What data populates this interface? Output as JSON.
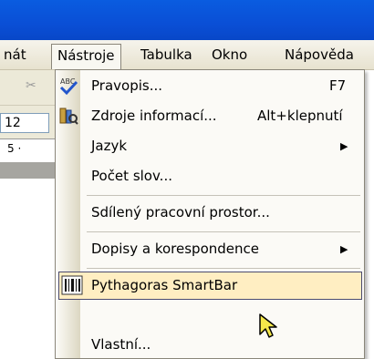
{
  "menubar": {
    "items": [
      {
        "label": "nát"
      },
      {
        "label": "Nástroje"
      },
      {
        "label": "Tabulka"
      },
      {
        "label": "Okno"
      },
      {
        "label": "Nápověda"
      }
    ]
  },
  "toolbar": {
    "font_size": "12",
    "ruler_text": "5 ·"
  },
  "menu": {
    "items": [
      {
        "label": "Pravopis...",
        "shortcut": "F7",
        "icon": "spellcheck-abc-icon"
      },
      {
        "label": "Zdroje informací...",
        "shortcut": "Alt+klepnutí",
        "icon": "research-books-icon"
      },
      {
        "label": "Jazyk",
        "submenu": true
      },
      {
        "label": "Počet slov..."
      },
      {
        "label": "Sdílený pracovní prostor..."
      },
      {
        "label": "Dopisy a korespondence",
        "submenu": true
      },
      {
        "label": "Pythagoras SmartBar",
        "icon": "barcode-icon",
        "highlighted": true
      },
      {
        "label": "Vlastní..."
      }
    ]
  },
  "colors": {
    "titlebar": "#0a5ce0",
    "menu_background": "#fbfaf6",
    "highlight_fill": "#ffeec2",
    "highlight_border": "#4b4b6f"
  }
}
